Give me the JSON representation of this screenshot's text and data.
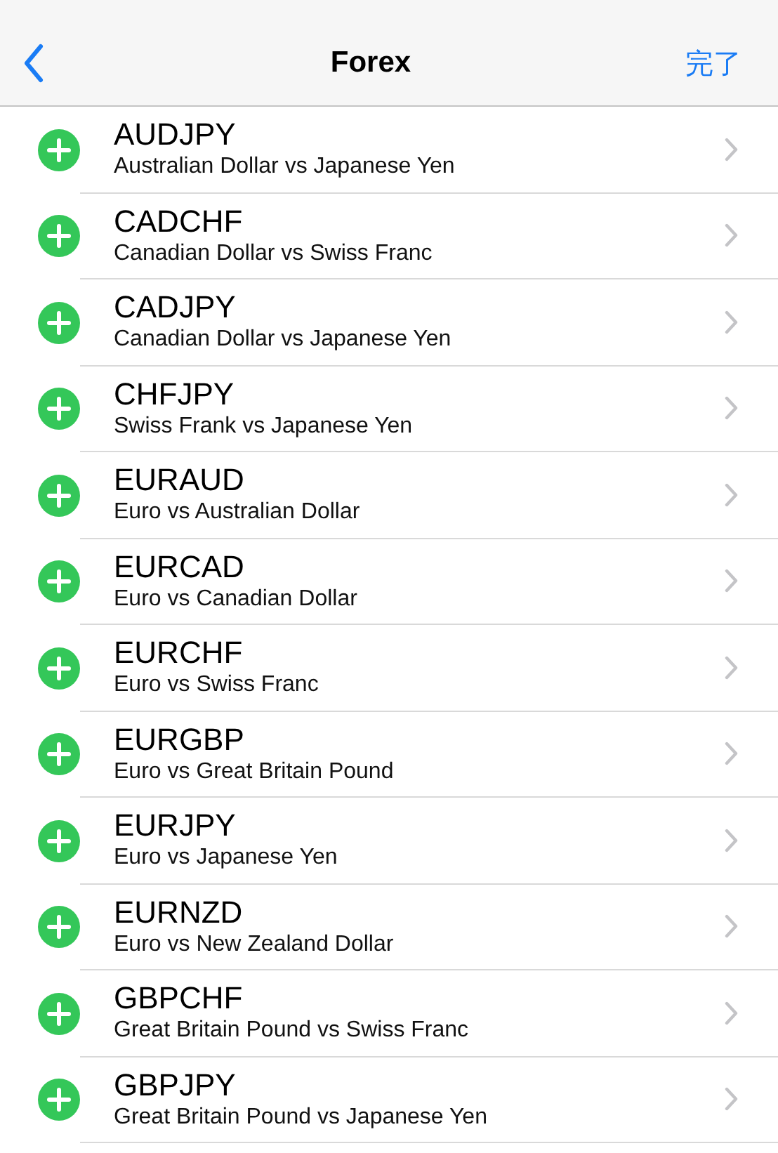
{
  "nav_bar": {
    "title": "Forex",
    "done_label": "完了"
  },
  "symbols": [
    {
      "code": "AUDJPY",
      "description": "Australian Dollar vs Japanese Yen"
    },
    {
      "code": "CADCHF",
      "description": "Canadian Dollar vs Swiss Franc"
    },
    {
      "code": "CADJPY",
      "description": "Canadian Dollar vs Japanese Yen"
    },
    {
      "code": "CHFJPY",
      "description": "Swiss Frank vs Japanese Yen"
    },
    {
      "code": "EURAUD",
      "description": "Euro vs Australian Dollar"
    },
    {
      "code": "EURCAD",
      "description": "Euro vs Canadian Dollar"
    },
    {
      "code": "EURCHF",
      "description": "Euro vs Swiss Franc"
    },
    {
      "code": "EURGBP",
      "description": "Euro vs Great Britain Pound"
    },
    {
      "code": "EURJPY",
      "description": "Euro vs Japanese Yen"
    },
    {
      "code": "EURNZD",
      "description": "Euro vs New Zealand Dollar"
    },
    {
      "code": "GBPCHF",
      "description": "Great Britain Pound vs Swiss Franc"
    },
    {
      "code": "GBPJPY",
      "description": "Great Britain Pound vs Japanese Yen"
    }
  ]
}
